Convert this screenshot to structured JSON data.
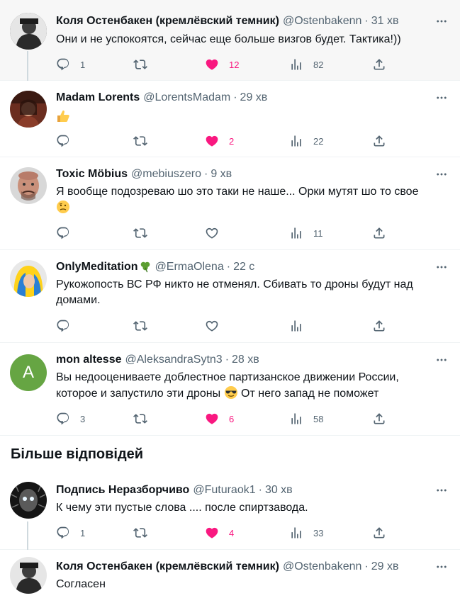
{
  "tweets": [
    {
      "name": "Коля Остенбакен (кремлёвский темник)",
      "handle": "@Ostenbakenn",
      "time": "31 хв",
      "text": "Они и не успокоятся, сейчас еще больше визгов будет. Тактика!))",
      "reply_count": "1",
      "like_count": "12",
      "view_count": "82"
    },
    {
      "name": "Madam Lorents",
      "handle": "@LorentsMadam",
      "time": "29 хв",
      "emoji": "thumbs-up",
      "like_count": "2",
      "view_count": "22"
    },
    {
      "name": "Toxic Möbius",
      "handle": "@mebiuszero",
      "time": "9 хв",
      "text": "Я вообще подозреваю шо это таки не наше... Орки мутят шо то свое",
      "emoji": "confused-face",
      "view_count": "11"
    },
    {
      "name": "OnlyMeditation",
      "name_emoji": "shamrock",
      "handle": "@ErmaOlena",
      "time": "22 с",
      "text": "Рукожопость ВС РФ никто не отменял. Сбивать то дроны будут над домами."
    },
    {
      "name": "mon altesse",
      "handle": "@AleksandraSytn3",
      "time": "28 хв",
      "avatar_letter": "A",
      "text_part1": "Вы недооцениваете доблестное партизанское движении России, которое и запустило эти дроны",
      "text_part2": "От него запад не поможет",
      "reply_count": "3",
      "like_count": "6",
      "view_count": "58"
    },
    {
      "name": "Подпись Неразборчиво",
      "handle": "@Futuraok1",
      "time": "30 хв",
      "text": "К чему эти пустые слова .... после спиртзавода.",
      "reply_count": "1",
      "like_count": "4",
      "view_count": "33"
    },
    {
      "name": "Коля Остенбакен (кремлёвский темник)",
      "handle": "@Ostenbakenn",
      "time": "29 хв",
      "text": "Согласен"
    }
  ],
  "section_title": "Більше відповідей",
  "colors": {
    "like_pink": "#f91880",
    "muted": "#536471",
    "avatar_green": "#66a543",
    "highlight_bg": "#f7f7f7"
  }
}
